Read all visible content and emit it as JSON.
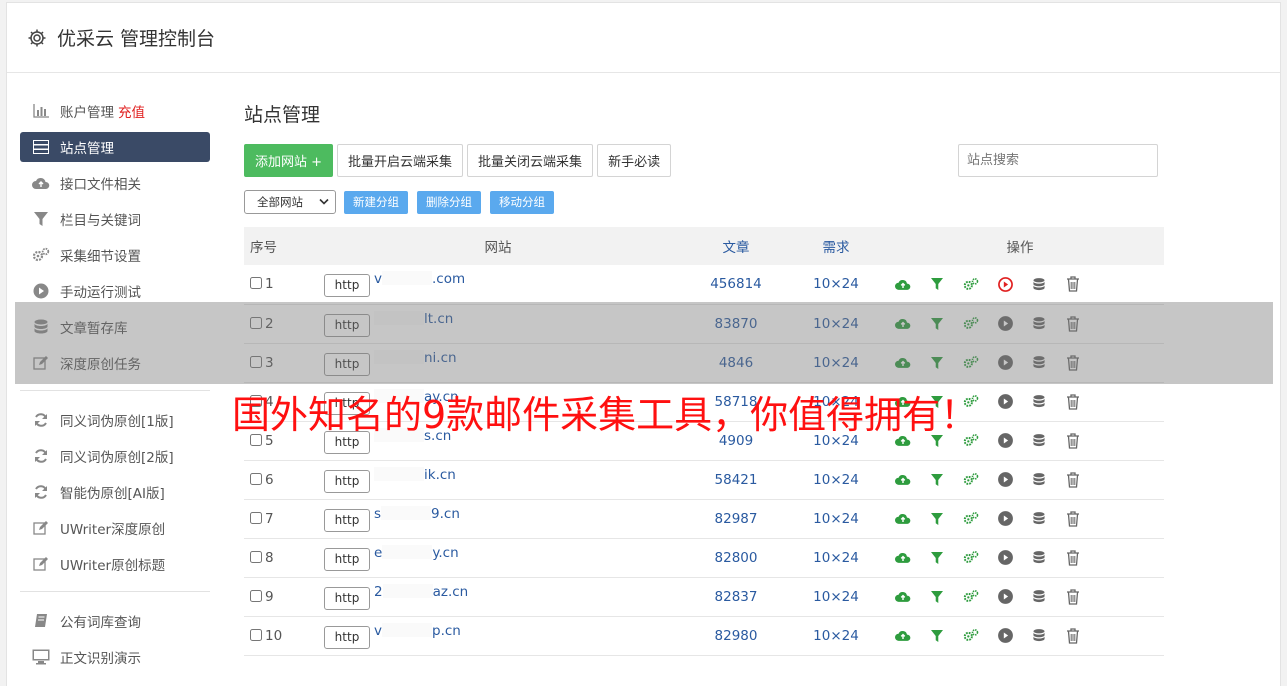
{
  "header": {
    "title": "优采云 管理控制台"
  },
  "sidebar": {
    "items": [
      {
        "label": "账户管理",
        "extra": "充值",
        "icon": "bar-chart-icon"
      },
      {
        "label": "站点管理",
        "icon": "server-icon",
        "active": true
      },
      {
        "label": "接口文件相关",
        "icon": "cloud-upload-icon"
      },
      {
        "label": "栏目与关键词",
        "icon": "filter-icon"
      },
      {
        "label": "采集细节设置",
        "icon": "gears-icon"
      },
      {
        "label": "手动运行测试",
        "icon": "play-icon"
      },
      {
        "label": "文章暂存库",
        "icon": "database-icon"
      },
      {
        "label": "深度原创任务",
        "icon": "edit-icon"
      }
    ],
    "group2": [
      {
        "label": "同义词伪原创[1版]",
        "icon": "refresh-icon"
      },
      {
        "label": "同义词伪原创[2版]",
        "icon": "refresh-icon"
      },
      {
        "label": "智能伪原创[AI版]",
        "icon": "refresh-icon"
      },
      {
        "label": "UWriter深度原创",
        "icon": "edit-icon"
      },
      {
        "label": "UWriter原创标题",
        "icon": "edit-icon"
      }
    ],
    "group3": [
      {
        "label": "公有词库查询",
        "icon": "book-icon"
      },
      {
        "label": "正文识别演示",
        "icon": "monitor-icon"
      }
    ]
  },
  "main": {
    "title": "站点管理",
    "toolbar": {
      "add_site": "添加网站 +",
      "batch_open": "批量开启云端采集",
      "batch_close": "批量关闭云端采集",
      "newbie": "新手必读",
      "search_placeholder": "站点搜索"
    },
    "group_select": "全部网站",
    "group_buttons": [
      "新建分组",
      "删除分组",
      "移动分组"
    ],
    "table": {
      "headers": [
        "序号",
        "网站",
        "文章",
        "需求",
        "操作"
      ],
      "http_label": "http",
      "rows": [
        {
          "no": "1",
          "site_prefix": "v",
          "site_suffix": ".com",
          "articles": "456814",
          "req": "10×24"
        },
        {
          "no": "2",
          "site_prefix": "",
          "site_suffix": "lt.cn",
          "articles": "83870",
          "req": "10×24"
        },
        {
          "no": "3",
          "site_prefix": "",
          "site_suffix": "ni.cn",
          "articles": "4846",
          "req": "10×24"
        },
        {
          "no": "4",
          "site_prefix": "",
          "site_suffix": "ay.cn",
          "articles": "58718",
          "req": "10×24"
        },
        {
          "no": "5",
          "site_prefix": "",
          "site_suffix": "s.cn",
          "articles": "4909",
          "req": "10×24"
        },
        {
          "no": "6",
          "site_prefix": "",
          "site_suffix": "ik.cn",
          "articles": "58421",
          "req": "10×24"
        },
        {
          "no": "7",
          "site_prefix": "s",
          "site_suffix": "9.cn",
          "articles": "82987",
          "req": "10×24"
        },
        {
          "no": "8",
          "site_prefix": "e",
          "site_suffix": "y.cn",
          "articles": "82800",
          "req": "10×24"
        },
        {
          "no": "9",
          "site_prefix": "2",
          "site_suffix": "az.cn",
          "articles": "82837",
          "req": "10×24"
        },
        {
          "no": "10",
          "site_prefix": "v",
          "site_suffix": "p.cn",
          "articles": "82980",
          "req": "10×24"
        }
      ]
    }
  },
  "banner": {
    "text": "国外知名的9款邮件采集工具，你值得拥有！"
  },
  "colors": {
    "accent_green": "#4dbb5f",
    "sidebar_active": "#3a4a66",
    "link_blue": "#2a5aa0",
    "banner_red": "#ff1010",
    "play_red": "#e02020"
  }
}
